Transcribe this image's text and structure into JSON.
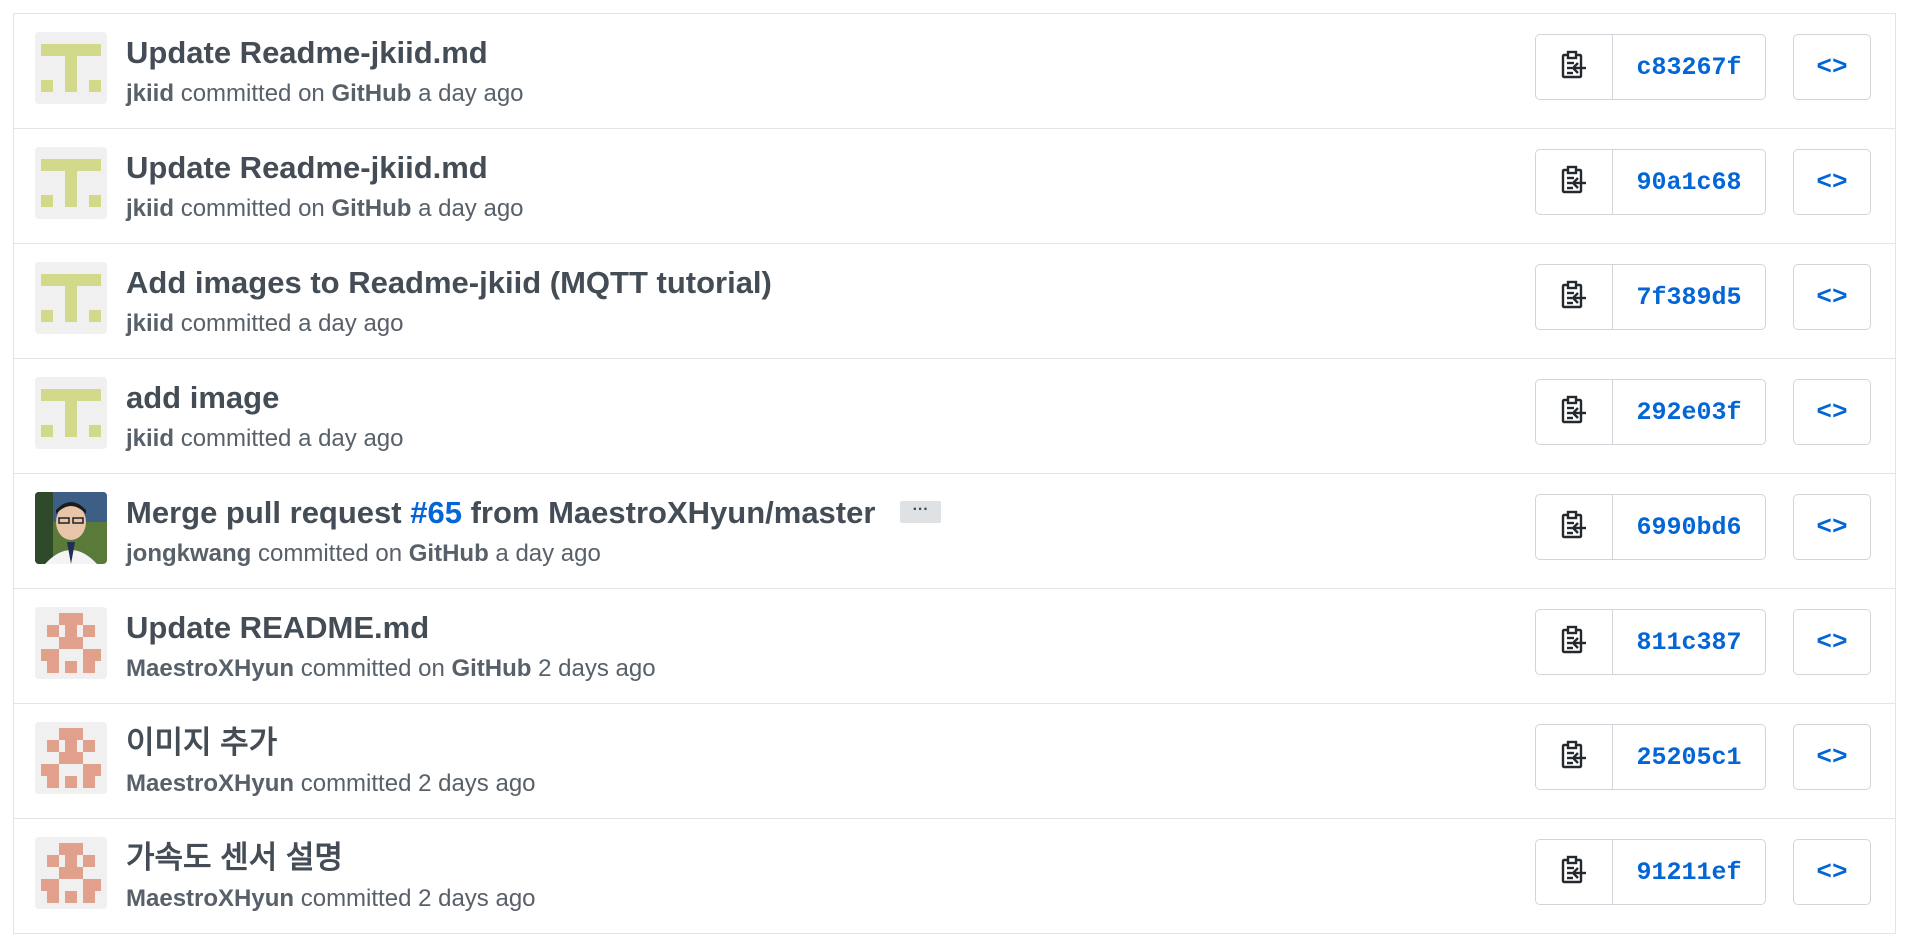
{
  "commits": [
    {
      "title": "Update Readme-jkiid.md",
      "author": "jkiid",
      "committed_text": "committed",
      "via": "on",
      "via_name": "GitHub",
      "time": "a day ago",
      "sha": "c83267f",
      "avatar": "jkiid-identicon"
    },
    {
      "title": "Update Readme-jkiid.md",
      "author": "jkiid",
      "committed_text": "committed",
      "via": "on",
      "via_name": "GitHub",
      "time": "a day ago",
      "sha": "90a1c68",
      "avatar": "jkiid-identicon"
    },
    {
      "title": "Add images to Readme-jkiid (MQTT tutorial)",
      "author": "jkiid",
      "committed_text": "committed",
      "time": "a day ago",
      "sha": "7f389d5",
      "avatar": "jkiid-identicon"
    },
    {
      "title": "add image",
      "author": "jkiid",
      "committed_text": "committed",
      "time": "a day ago",
      "sha": "292e03f",
      "avatar": "jkiid-identicon"
    },
    {
      "title_prefix": "Merge pull request",
      "issue": "#65",
      "title_suffix": "from MaestroXHyun/master",
      "ellipsis": "···",
      "author": "jongkwang",
      "committed_text": "committed",
      "via": "on",
      "via_name": "GitHub",
      "time": "a day ago",
      "sha": "6990bd6",
      "avatar": "jongkwang-photo"
    },
    {
      "title": "Update README.md",
      "author": "MaestroXHyun",
      "committed_text": "committed",
      "via": "on",
      "via_name": "GitHub",
      "time": "2 days ago",
      "sha": "811c387",
      "avatar": "maestroxhyun-identicon"
    },
    {
      "title": "이미지 추가",
      "author": "MaestroXHyun",
      "committed_text": "committed",
      "time": "2 days ago",
      "sha": "25205c1",
      "avatar": "maestroxhyun-identicon"
    },
    {
      "title": "가속도 센서 설명",
      "author": "MaestroXHyun",
      "committed_text": "committed",
      "time": "2 days ago",
      "sha": "91211ef",
      "avatar": "maestroxhyun-identicon"
    }
  ],
  "icons": {
    "copy": "clippy-icon",
    "browse": "code-icon",
    "browse_glyph": "<>"
  },
  "colors": {
    "sha_link": "#0366d6",
    "title_text": "#444d56",
    "meta_text": "#586069",
    "identicon_green": "#d3d98a",
    "identicon_red": "#e0a08c",
    "border": "#e1e4e8"
  }
}
